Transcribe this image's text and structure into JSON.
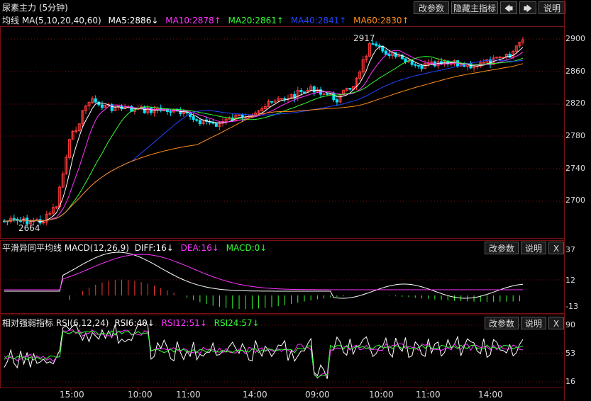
{
  "title": "尿素主力 (5分钟)",
  "toolbar": {
    "modify_params": "改参数",
    "hide_main_indicator": "隐藏主指标",
    "left_arrow": "🡄",
    "right_arrow": "🡆",
    "help": "说明"
  },
  "ma_legend": {
    "label": "均线 MA(5,10,20,40,60)",
    "ma5": "MA5:2886↓",
    "ma10": "MA10:2878↑",
    "ma20": "MA20:2861↑",
    "ma40": "MA40:2841↑",
    "ma60": "MA60:2830↑"
  },
  "macd_legend": {
    "label": "平滑异同平均线 MACD(12,26,9)",
    "diff": "DIFF:16↓",
    "dea": "DEA:16↓",
    "macd": "MACD:0↓",
    "modify_params": "改参数",
    "help": "说明",
    "close": "X"
  },
  "rsi_legend": {
    "label": "相对强弱指标 RSI(6,12,24)",
    "rsi6": "RSI6:40↓",
    "rsi12": "RSI12:51↓",
    "rsi24": "RSI24:57↓",
    "modify_params": "改参数",
    "help": "说明",
    "close": "X"
  },
  "price_axis": [
    "2900",
    "2860",
    "2820",
    "2780",
    "2740",
    "2700"
  ],
  "macd_axis": [
    "37",
    "12",
    "-13"
  ],
  "rsi_axis": [
    "90",
    "53",
    "16"
  ],
  "time_axis": [
    "15:00",
    "10:00",
    "11:00",
    "14:00",
    "09:00",
    "10:00",
    "11:00",
    "14:00"
  ],
  "annotations": {
    "high": "2917",
    "low": "2664"
  },
  "colors": {
    "up": "#ff3b3b",
    "down": "#00e5ff",
    "ma5": "#ffffff",
    "ma10": "#ff33ff",
    "ma20": "#33ff33",
    "ma40": "#2244ff",
    "ma60": "#ff8c1a",
    "grid": "#7a1010"
  }
}
